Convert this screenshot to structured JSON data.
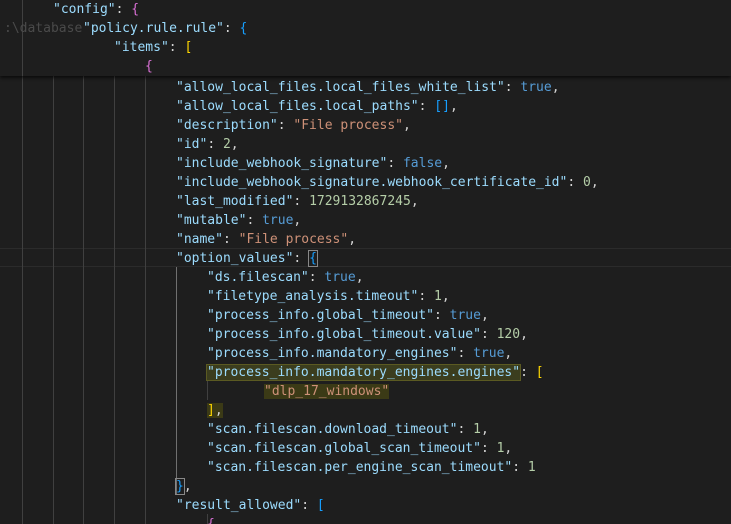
{
  "editor": {
    "background": "#1e1e1e",
    "path_ghost": ":\\database",
    "sticky_lines": [
      {
        "key": "\"config\"",
        "punct": ": ",
        "bracket": "{"
      },
      {
        "key": "\"policy.rule.rule\"",
        "punct": ": ",
        "bracket": "{"
      },
      {
        "key": "\"items\"",
        "punct": ": ",
        "bracket": "["
      },
      {
        "bracket": "{"
      }
    ],
    "lines": [
      {
        "key": "\"allow_local_files.local_files_white_list\"",
        "punct": ": ",
        "value": "true",
        "vtype": "b",
        "end": ","
      },
      {
        "key": "\"allow_local_files.local_paths\"",
        "punct": ": ",
        "value": "[]",
        "vtype": "br",
        "end": ","
      },
      {
        "key": "\"description\"",
        "punct": ": ",
        "value": "\"File process\"",
        "vtype": "s",
        "end": ","
      },
      {
        "key": "\"id\"",
        "punct": ": ",
        "value": "2",
        "vtype": "n",
        "end": ","
      },
      {
        "key": "\"include_webhook_signature\"",
        "punct": ": ",
        "value": "false",
        "vtype": "b",
        "end": ","
      },
      {
        "key": "\"include_webhook_signature.webhook_certificate_id\"",
        "punct": ": ",
        "value": "0",
        "vtype": "n",
        "end": ","
      },
      {
        "key": "\"last_modified\"",
        "punct": ": ",
        "value": "1729132867245",
        "vtype": "n",
        "end": ","
      },
      {
        "key": "\"mutable\"",
        "punct": ": ",
        "value": "true",
        "vtype": "b",
        "end": ","
      },
      {
        "key": "\"name\"",
        "punct": ": ",
        "value": "\"File process\"",
        "vtype": "s",
        "end": ","
      },
      {
        "key": "\"option_values\"",
        "punct": ": ",
        "value": "{",
        "vtype": "br3",
        "end": ""
      },
      {
        "key": "\"ds.filescan\"",
        "punct": ": ",
        "value": "true",
        "vtype": "b",
        "end": ","
      },
      {
        "key": "\"filetype_analysis.timeout\"",
        "punct": ": ",
        "value": "1",
        "vtype": "n",
        "end": ","
      },
      {
        "key": "\"process_info.global_timeout\"",
        "punct": ": ",
        "value": "true",
        "vtype": "b",
        "end": ","
      },
      {
        "key": "\"process_info.global_timeout.value\"",
        "punct": ": ",
        "value": "120",
        "vtype": "n",
        "end": ","
      },
      {
        "key": "\"process_info.mandatory_engines\"",
        "punct": ": ",
        "value": "true",
        "vtype": "b",
        "end": ","
      },
      {
        "key": "\"process_info.mandatory_engines.engines\"",
        "punct": ": ",
        "value": "[",
        "vtype": "br1",
        "end": ""
      },
      {
        "value": "\"dlp_17_windows\"",
        "vtype": "s",
        "end": ""
      },
      {
        "value": "]",
        "vtype": "br1",
        "end": ","
      },
      {
        "key": "\"scan.filescan.download_timeout\"",
        "punct": ": ",
        "value": "1",
        "vtype": "n",
        "end": ","
      },
      {
        "key": "\"scan.filescan.global_scan_timeout\"",
        "punct": ": ",
        "value": "1",
        "vtype": "n",
        "end": ","
      },
      {
        "key": "\"scan.filescan.per_engine_scan_timeout\"",
        "punct": ": ",
        "value": "1",
        "vtype": "n",
        "end": ""
      },
      {
        "value": "}",
        "vtype": "br3",
        "end": ","
      },
      {
        "key": "\"result_allowed\"",
        "punct": ": ",
        "value": "[",
        "vtype": "br3",
        "end": ""
      },
      {
        "value": "{",
        "vtype": "br2",
        "end": ""
      }
    ]
  }
}
